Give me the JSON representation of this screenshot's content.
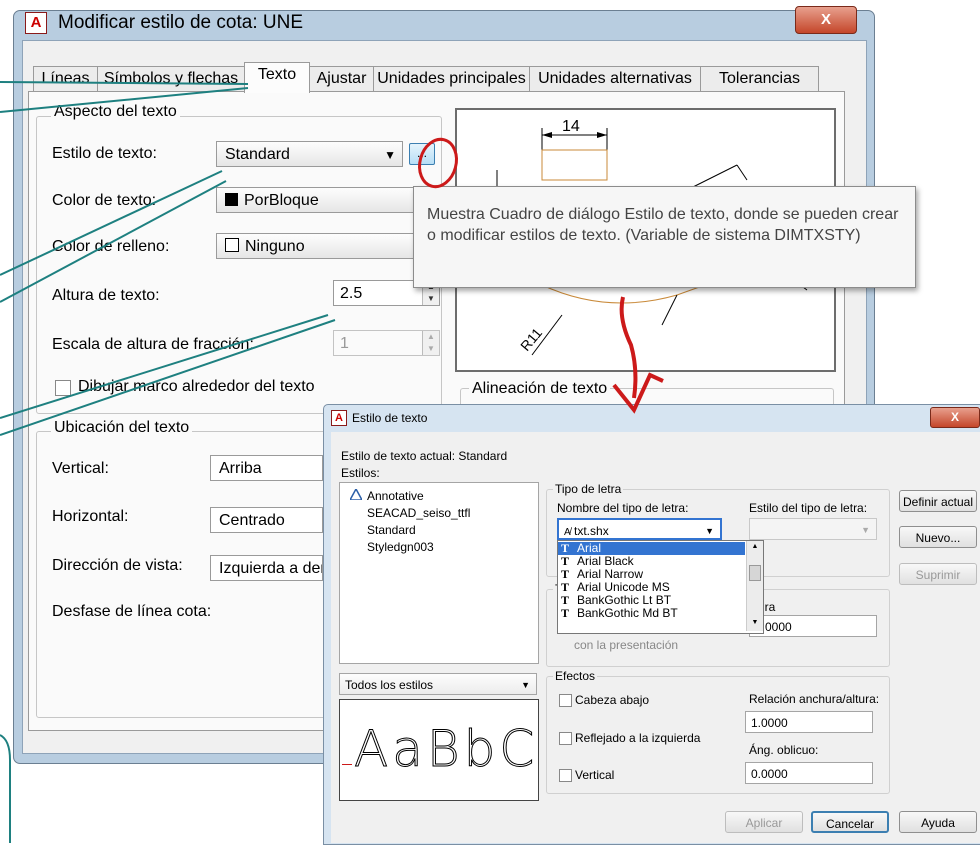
{
  "main_dialog": {
    "title": "Modificar estilo de cota: UNE",
    "close_glyph": "X",
    "tabs": [
      "Líneas",
      "Símbolos y flechas",
      "Texto",
      "Ajustar",
      "Unidades principales",
      "Unidades alternativas",
      "Tolerancias"
    ],
    "aspecto": {
      "group_title": "Aspecto del texto",
      "estilo_label": "Estilo de texto:",
      "estilo_value": "Standard",
      "ellipsis": "...",
      "color_label": "Color de texto:",
      "color_value": "PorBloque",
      "relleno_label": "Color de relleno:",
      "relleno_value": "Ninguno",
      "altura_label": "Altura de texto:",
      "altura_value": "2.5",
      "escala_label": "Escala de altura de fracción:",
      "escala_value": "1",
      "marco_label": "Dibujar marco alrededor del texto"
    },
    "ubicacion": {
      "group_title": "Ubicación del texto",
      "vertical_label": "Vertical:",
      "vertical_value": "Arriba",
      "horizontal_label": "Horizontal:",
      "horizontal_value": "Centrado",
      "direccion_label": "Dirección de vista:",
      "direccion_value": "Izquierda a der",
      "desfase_label": "Desfase de línea cota:"
    },
    "preview": {
      "dim_14": "14",
      "dim_r11": "R11"
    },
    "alineacion_title": "Alineación de texto"
  },
  "tooltip": {
    "text": "Muestra Cuadro de diálogo Estilo de texto, donde se pueden crear o modificar estilos de texto. (Variable de sistema DIMTXSTY)"
  },
  "text_style_dialog": {
    "title": "Estilo de texto",
    "close_glyph": "X",
    "current_label": "Estilo de texto actual:",
    "current_value": "Standard",
    "estilos_label": "Estilos:",
    "styles": [
      "Annotative",
      "SEACAD_seiso_ttfl",
      "Standard",
      "Styledgn003"
    ],
    "filter_value": "Todos los estilos",
    "preview_text": "AaBbCc",
    "tipo_letra_title": "Tipo de letra",
    "nombre_label": "Nombre del tipo de letra:",
    "nombre_value": "txt.shx",
    "estilo_tipo_label": "Estilo del tipo de letra:",
    "font_list": [
      "Arial",
      "Arial Black",
      "Arial Narrow",
      "Arial Unicode MS",
      "BankGothic Lt BT",
      "BankGothic Md BT"
    ],
    "tamano_title_fragment": "T",
    "altura_fragment": "ura",
    "altura_value": "0.0000",
    "presentacion_fragment": "con la presentación",
    "efectos_title": "Efectos",
    "cabeza_abajo": "Cabeza abajo",
    "reflejado": "Reflejado a la izquierda",
    "vertical": "Vertical",
    "relacion_label": "Relación anchura/altura:",
    "relacion_value": "1.0000",
    "oblicuo_label": "Áng. oblicuo:",
    "oblicuo_value": "0.0000",
    "buttons": {
      "definir": "Definir actual",
      "nuevo": "Nuevo...",
      "suprimir": "Suprimir",
      "aplicar": "Aplicar",
      "cancelar": "Cancelar",
      "ayuda": "Ayuda"
    }
  },
  "colors": {
    "callout_line": "#1e8080",
    "annotation_red": "#cc1a1a",
    "selection_blue": "#3374d1",
    "dim_orange": "#c98a3a"
  }
}
